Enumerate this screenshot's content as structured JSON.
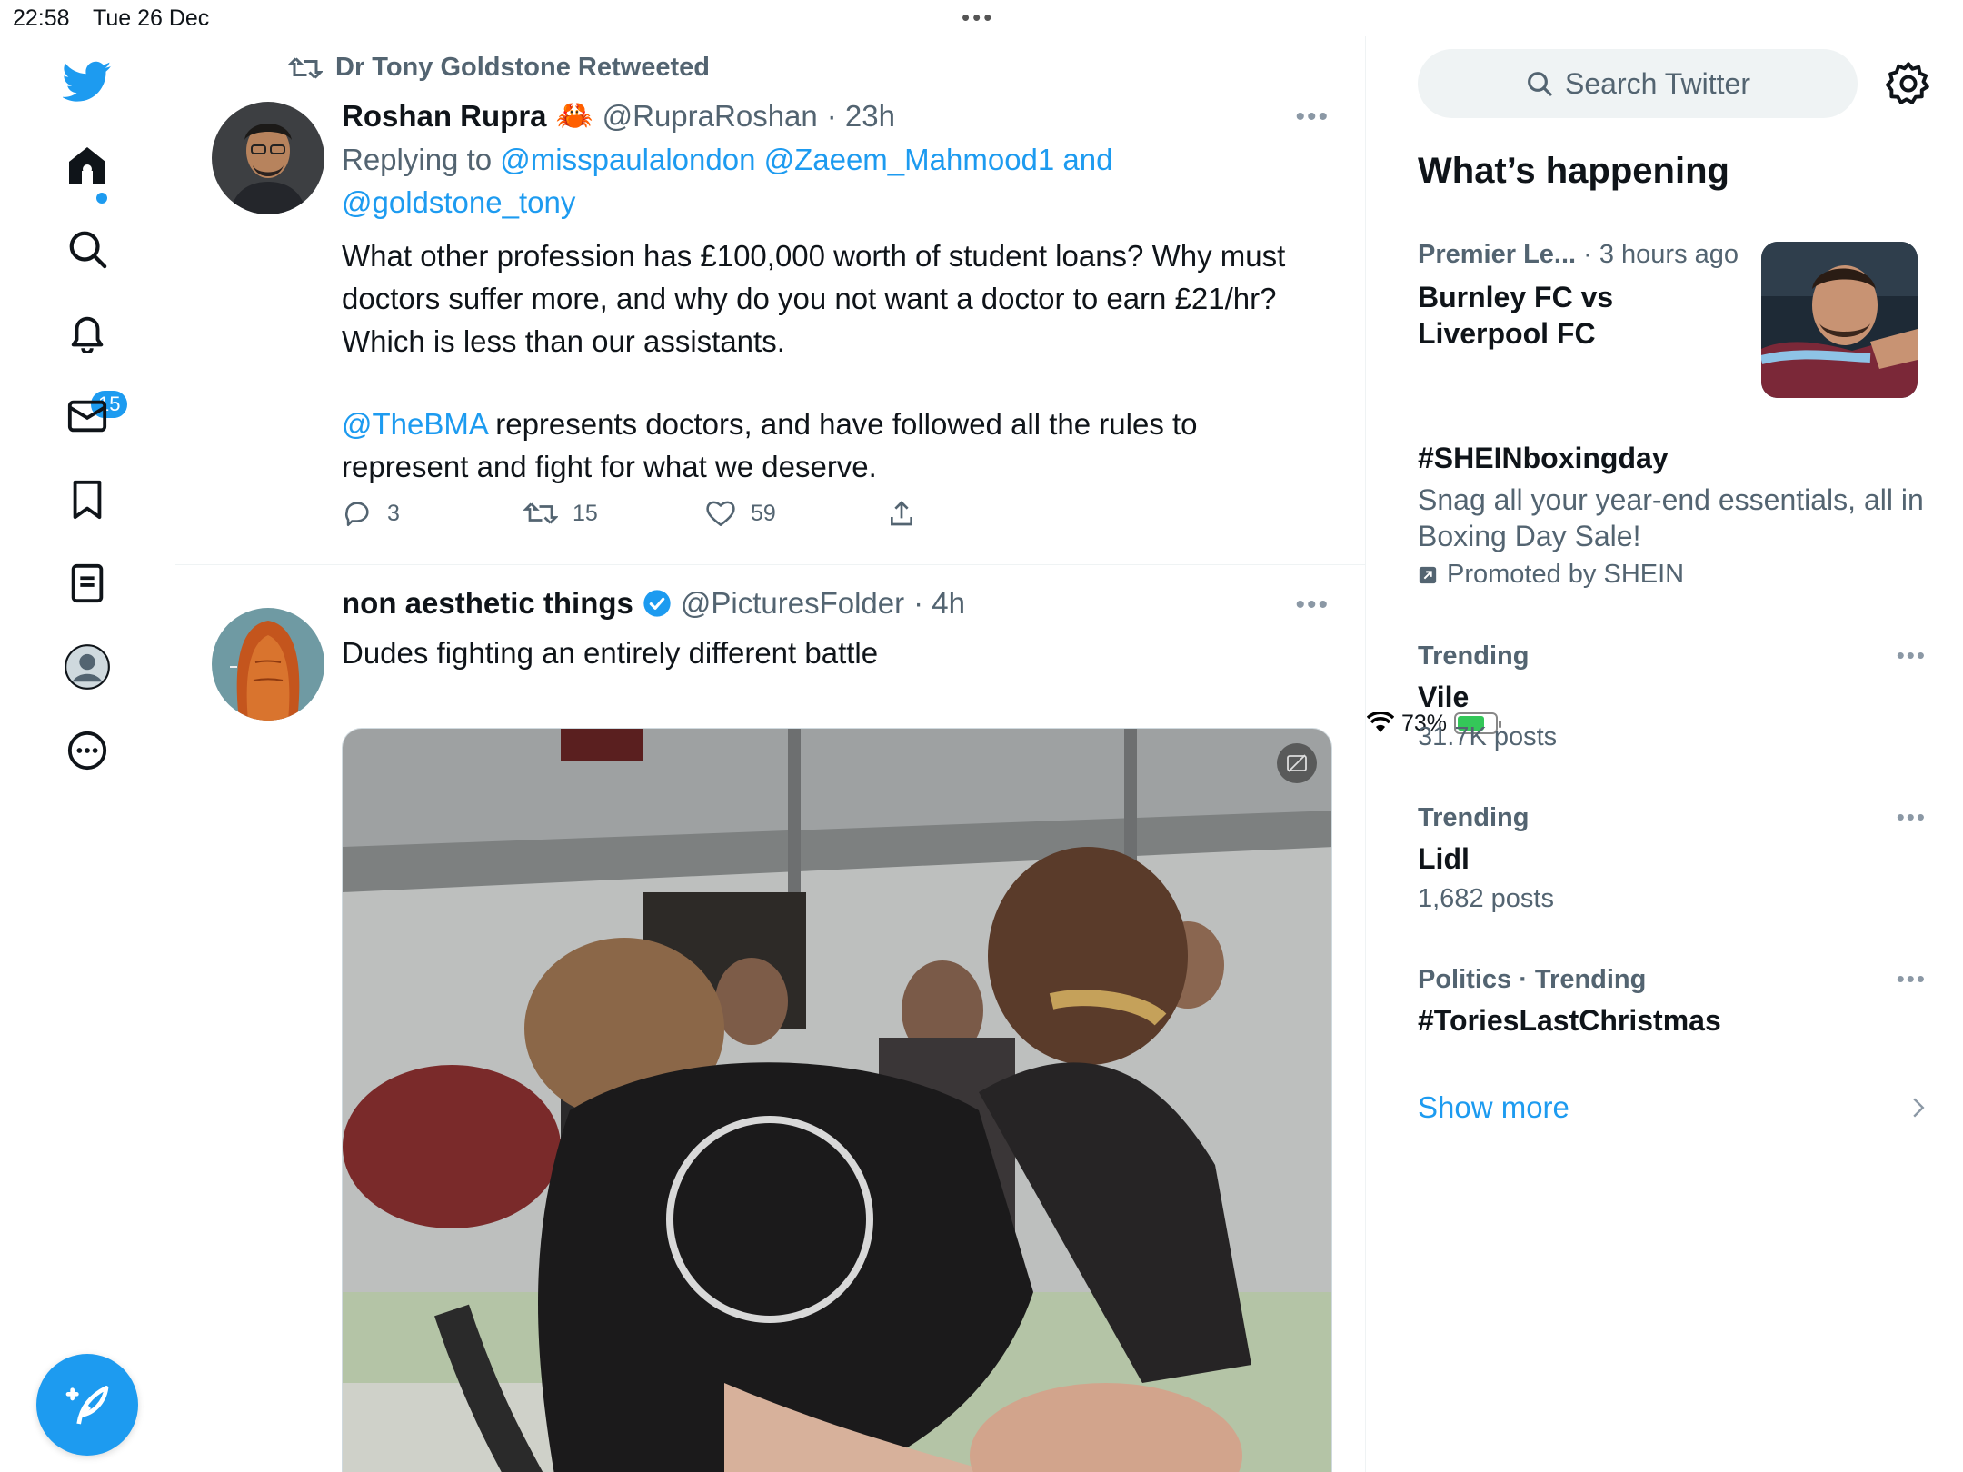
{
  "status_bar": {
    "time": "22:58",
    "date": "Tue 26 Dec",
    "battery": "73%"
  },
  "nav": {
    "notifications_badge": "15",
    "items": [
      "twitter-logo",
      "home",
      "explore",
      "notifications",
      "messages",
      "bookmarks",
      "lists",
      "profile",
      "more"
    ]
  },
  "tweets": [
    {
      "retweeted_by": "Dr Tony Goldstone Retweeted",
      "name": "Roshan Rupra",
      "emoji": "🦀",
      "handle": "@RupraRoshan",
      "time": "· 23h",
      "replying_prefix": "Replying to ",
      "replying_to": "@misspaulalondon @Zaeem_Mahmood1 and @goldstone_tony",
      "text1": "What other profession has £100,000 worth of student loans? Why must doctors suffer more, and why do you not want a doctor to earn £21/hr? Which is less than our assistants.",
      "mention": "@TheBMA",
      "text2": " represents doctors, and have followed all the rules to represent and fight for what we deserve.",
      "replies": "3",
      "retweets": "15",
      "likes": "59"
    },
    {
      "name": "non aesthetic things",
      "handle": "@PicturesFolder",
      "time": "· 4h",
      "text": "Dudes fighting an entirely different battle"
    }
  ],
  "sidebar": {
    "search_placeholder": "Search Twitter",
    "title": "What’s happening",
    "trends": [
      {
        "meta": "Premier Le...",
        "meta_time": " · 3 hours ago",
        "headline": "Burnley FC vs Liverpool FC"
      },
      {
        "headline": "#SHEINboxingday",
        "desc": "Snag all your year-end essentials, all in Boxing Day Sale!",
        "promoted": "Promoted by SHEIN"
      },
      {
        "meta": "Trending",
        "headline": "Vile",
        "count": "31.7K posts"
      },
      {
        "meta": "Trending",
        "headline": "Lidl",
        "count": "1,682 posts"
      },
      {
        "meta": "Politics · Trending",
        "headline": "#ToriesLastChristmas"
      }
    ],
    "show_more": "Show more"
  },
  "colors": {
    "accent": "#1d9bf0",
    "secondary_text": "#536471",
    "border": "#eff3f4"
  }
}
